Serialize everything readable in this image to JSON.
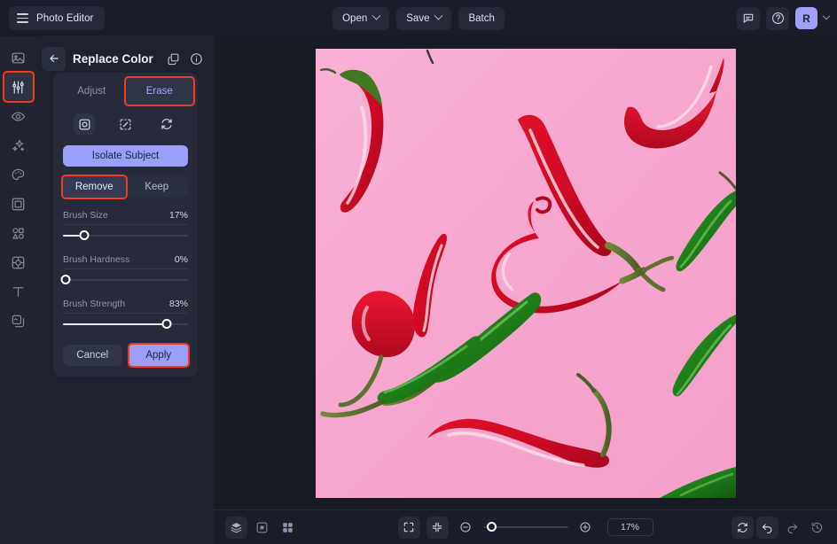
{
  "app": {
    "brand": "Photo Editor",
    "menu_icon": "hamburger-icon"
  },
  "topbar": {
    "open_label": "Open",
    "save_label": "Save",
    "batch_label": "Batch",
    "comment_icon": "comment-icon",
    "help_icon": "help-circle-icon",
    "avatar_initial": "R"
  },
  "sidebar": {
    "items": [
      {
        "name": "image",
        "icon": "image-icon"
      },
      {
        "name": "adjust",
        "icon": "sliders-icon",
        "active": true,
        "highlighted": true
      },
      {
        "name": "retouch",
        "icon": "eye-icon"
      },
      {
        "name": "effects",
        "icon": "sparkles-icon"
      },
      {
        "name": "color",
        "icon": "palette-icon"
      },
      {
        "name": "frame",
        "icon": "frame-icon"
      },
      {
        "name": "shapes",
        "icon": "shapes-icon"
      },
      {
        "name": "ai-tools",
        "icon": "ai-square-icon"
      },
      {
        "name": "text",
        "icon": "text-icon"
      },
      {
        "name": "layers",
        "icon": "layers-copy-icon"
      }
    ]
  },
  "panel": {
    "title": "Replace Color",
    "back_icon": "arrow-left-icon",
    "duplicate_icon": "duplicate-icon",
    "info_icon": "info-icon",
    "tabs": [
      {
        "label": "Adjust",
        "active": false,
        "highlighted": false
      },
      {
        "label": "Erase",
        "active": true,
        "highlighted": true
      }
    ],
    "tools": [
      {
        "name": "brush-tool",
        "icon": "circle-square-icon",
        "selected": true
      },
      {
        "name": "magic-erase-tool",
        "icon": "dashed-square-slash-icon",
        "selected": false
      },
      {
        "name": "invert-tool",
        "icon": "refresh-swap-icon",
        "selected": false
      }
    ],
    "isolate_label": "Isolate Subject",
    "modes": [
      {
        "label": "Remove",
        "active": true,
        "highlighted": true
      },
      {
        "label": "Keep",
        "active": false,
        "highlighted": false
      }
    ],
    "sliders": [
      {
        "label": "Brush Size",
        "value": "17%",
        "percent": 17
      },
      {
        "label": "Brush Hardness",
        "value": "0%",
        "percent": 0
      },
      {
        "label": "Brush Strength",
        "value": "83%",
        "percent": 83
      }
    ],
    "cancel_label": "Cancel",
    "apply_label": "Apply"
  },
  "bottombar": {
    "left_icons": [
      {
        "name": "layers-icon",
        "filled": true
      },
      {
        "name": "link-broken-icon",
        "filled": false
      },
      {
        "name": "grid-icon",
        "filled": false
      }
    ],
    "fit_icon": "fit-screen-icon",
    "collapse_icon": "collapse-icon",
    "zoom_out_icon": "zoom-out-icon",
    "zoom_in_icon": "zoom-in-icon",
    "zoom_value": "17%",
    "right_icons": [
      {
        "name": "reset-view-icon",
        "filled": true
      },
      {
        "name": "undo-icon",
        "filled": true
      },
      {
        "name": "redo-icon",
        "filled": false
      },
      {
        "name": "history-icon",
        "filled": false
      }
    ]
  },
  "colors": {
    "accent": "#9b9efa",
    "highlight": "#ef3b22",
    "panel_bg": "#1f222d",
    "canvas_bg": "#191b24",
    "photo_bg": "#f7a8cf"
  },
  "photo": {
    "description": "red-and-green-chili-peppers-on-pink-background"
  }
}
